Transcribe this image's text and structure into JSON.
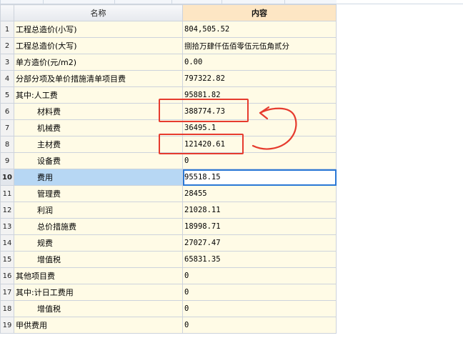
{
  "header": {
    "col_name": "名称",
    "col_content": "内容"
  },
  "rows": [
    {
      "num": "1",
      "name": "工程总造价(小写)",
      "value": "804,505.52",
      "indent": false
    },
    {
      "num": "2",
      "name": "工程总造价(大写)",
      "value": "捌拾万肆仟伍佰零伍元伍角贰分",
      "indent": false
    },
    {
      "num": "3",
      "name": "单方造价(元/m2)",
      "value": "0.00",
      "indent": false
    },
    {
      "num": "4",
      "name": "分部分项及单价措施清单项目费",
      "value": "797322.82",
      "indent": false
    },
    {
      "num": "5",
      "name": "其中:人工费",
      "value": "95881.82",
      "indent": false
    },
    {
      "num": "6",
      "name": "材料费",
      "value": "388774.73",
      "indent": true
    },
    {
      "num": "7",
      "name": "机械费",
      "value": "36495.1",
      "indent": true
    },
    {
      "num": "8",
      "name": "主材费",
      "value": "121420.61",
      "indent": true
    },
    {
      "num": "9",
      "name": "设备费",
      "value": "0",
      "indent": true
    },
    {
      "num": "10",
      "name": "费用",
      "value": "95518.15",
      "indent": true,
      "selected": true
    },
    {
      "num": "11",
      "name": "管理费",
      "value": "28455",
      "indent": true
    },
    {
      "num": "12",
      "name": "利润",
      "value": "21028.11",
      "indent": true
    },
    {
      "num": "13",
      "name": "总价措施费",
      "value": "18998.71",
      "indent": true
    },
    {
      "num": "14",
      "name": "规费",
      "value": "27027.47",
      "indent": true
    },
    {
      "num": "15",
      "name": "增值税",
      "value": "65831.35",
      "indent": true
    },
    {
      "num": "16",
      "name": "其他项目费",
      "value": "0",
      "indent": false
    },
    {
      "num": "17",
      "name": "其中:计日工费用",
      "value": "0",
      "indent": false
    },
    {
      "num": "18",
      "name": "增值税",
      "value": "0",
      "indent": true
    },
    {
      "num": "19",
      "name": "甲供费用",
      "value": "0",
      "indent": false
    }
  ],
  "colors": {
    "annotation": "#e63b2e",
    "selection": "#2a78d6",
    "row_bg": "#fffbe6",
    "header_accent": "#fde6c4"
  }
}
